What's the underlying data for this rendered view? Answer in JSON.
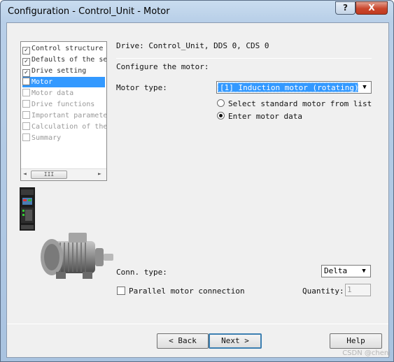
{
  "window": {
    "title": "Configuration - Control_Unit - Motor",
    "help_button": "?",
    "close_button": "X"
  },
  "tree": {
    "items": [
      {
        "label": "Control structure",
        "state": "checked"
      },
      {
        "label": "Defaults of the se",
        "state": "checked"
      },
      {
        "label": "Drive setting",
        "state": "checked"
      },
      {
        "label": "Motor",
        "state": "selected"
      },
      {
        "label": "Motor data",
        "state": "disabled"
      },
      {
        "label": "Drive functions",
        "state": "disabled"
      },
      {
        "label": "Important paramete",
        "state": "disabled"
      },
      {
        "label": "Calculation of the",
        "state": "disabled"
      },
      {
        "label": "Summary",
        "state": "disabled"
      }
    ],
    "scroll_left": "◄",
    "scroll_thumb": "III",
    "scroll_right": "►"
  },
  "main": {
    "drive_label": "Drive: Control_Unit, DDS 0, CDS 0",
    "configure_label": "Configure the motor:",
    "motor_type_label": "Motor type:",
    "motor_type_value": "[1] Induction motor (rotating)",
    "radio_standard": "Select standard motor from list",
    "radio_enter": "Enter motor data",
    "radio_selected": "enter",
    "conn_type_label": "Conn. type:",
    "conn_type_value": "Delta",
    "parallel_label": "Parallel motor connection",
    "parallel_checked": false,
    "quantity_label": "Quantity:",
    "quantity_value": "1"
  },
  "buttons": {
    "back": "< Back",
    "next": "Next >",
    "help": "Help"
  },
  "watermark": "CSDN @chenj"
}
